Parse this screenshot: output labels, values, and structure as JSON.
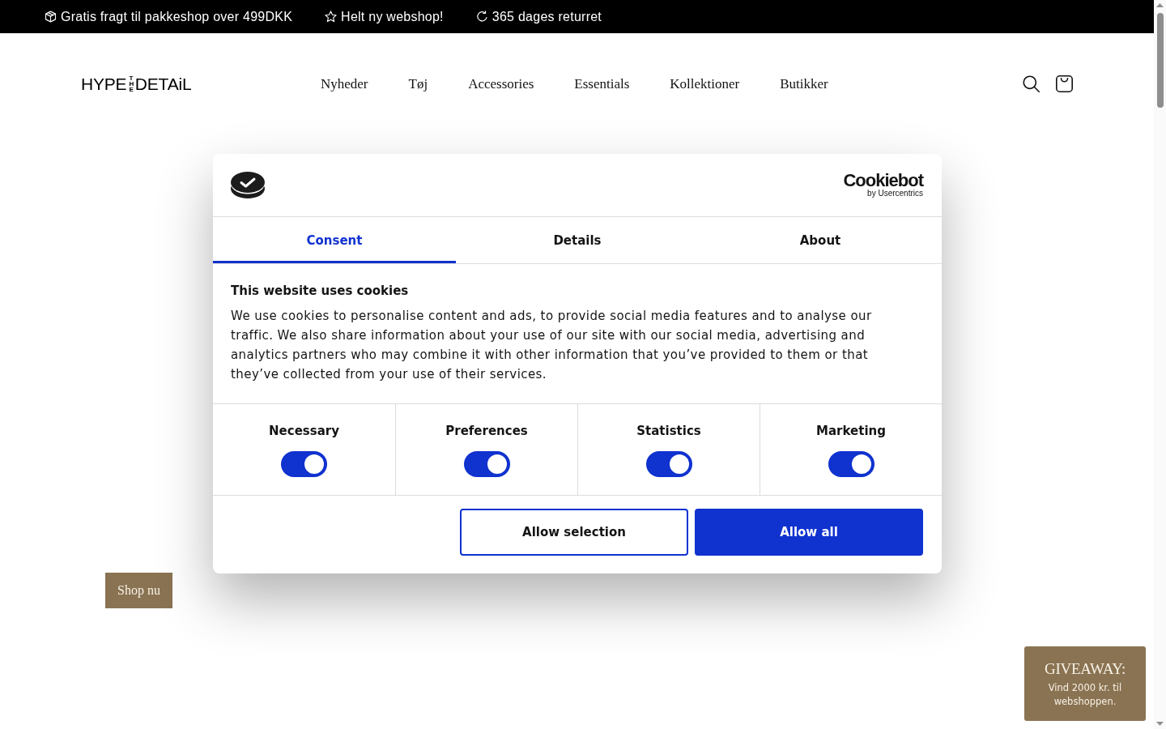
{
  "announcement_bar": [
    {
      "kind": "package",
      "text": "Gratis fragt til pakkeshop over 499DKK"
    },
    {
      "kind": "star",
      "text": "Helt ny webshop!"
    },
    {
      "kind": "return",
      "text": "365 dages returret"
    }
  ],
  "header": {
    "logo": {
      "first": "HYPE",
      "stacked": "THE",
      "last": "DETAiL"
    },
    "nav": [
      "Nyheder",
      "Tøj",
      "Accessories",
      "Essentials",
      "Kollektioner",
      "Butikker"
    ]
  },
  "cookie_dialog": {
    "brand": {
      "name": "Cookiebot",
      "byline": "by Usercentrics"
    },
    "tabs": [
      {
        "label": "Consent",
        "selected": true
      },
      {
        "label": "Details",
        "selected": false
      },
      {
        "label": "About",
        "selected": false
      }
    ],
    "heading": "This website uses cookies",
    "body": "We use cookies to personalise content and ads, to provide social media features and to analyse our traffic. We also share information about your use of our site with our social media, advertising and analytics partners who may combine it with other information that you’ve provided to them or that they’ve collected from your use of their services.",
    "toggles": [
      {
        "label": "Necessary",
        "checked": true
      },
      {
        "label": "Preferences",
        "checked": true
      },
      {
        "label": "Statistics",
        "checked": true
      },
      {
        "label": "Marketing",
        "checked": true
      }
    ],
    "buttons": [
      {
        "label": "Allow selection",
        "kind": "outline"
      },
      {
        "label": "Allow all",
        "kind": "primary"
      }
    ]
  },
  "hero": {
    "button": "Shop nu"
  },
  "giveaway": {
    "title": "GIVEAWAY:",
    "text": "Vind 2000 kr. til webshoppen."
  }
}
